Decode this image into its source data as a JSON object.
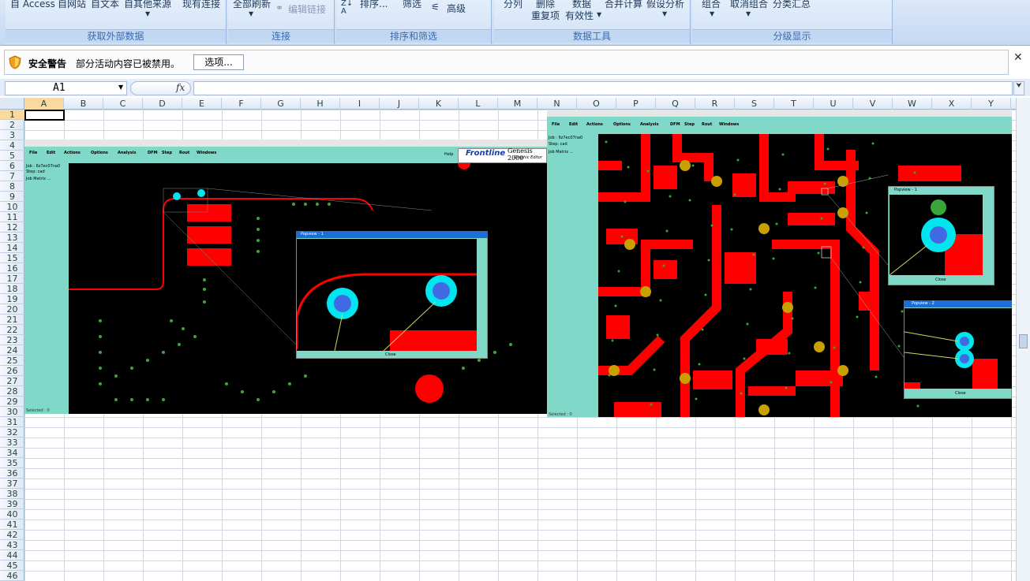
{
  "ribbon": {
    "external_data": {
      "label": "获取外部数据",
      "access": "自 Access",
      "web": "自网站",
      "text": "自文本",
      "other": "自其他来源",
      "existing": "现有连接"
    },
    "connections": {
      "label": "连接",
      "refresh_all": "全部刷新",
      "edit_links": "编辑链接"
    },
    "sort_filter": {
      "label": "排序和筛选",
      "sort": "排序...",
      "filter": "筛选",
      "advanced": "高级"
    },
    "data_tools": {
      "label": "数据工具",
      "split": "分列",
      "remove_dup": "删除",
      "remove_dup2": "重复项",
      "validation": "数据",
      "validation2": "有效性",
      "consolidate": "合并计算",
      "whatif": "假设分析"
    },
    "outline": {
      "label": "分级显示",
      "group": "组合",
      "ungroup": "取消组合",
      "subtotal": "分类汇总"
    }
  },
  "security_bar": {
    "title": "安全警告",
    "message": "部分活动内容已被禁用。",
    "options_button": "选项..."
  },
  "formula_bar": {
    "name_box": "A1",
    "fx": "fx",
    "formula": ""
  },
  "columns": [
    "A",
    "B",
    "C",
    "D",
    "E",
    "F",
    "G",
    "H",
    "I",
    "J",
    "K",
    "L",
    "M",
    "N",
    "O",
    "P",
    "Q",
    "R",
    "S",
    "T",
    "U",
    "V",
    "W",
    "X",
    "Y"
  ],
  "rows": [
    "1",
    "2",
    "3",
    "4",
    "5",
    "6",
    "7",
    "8",
    "9",
    "10",
    "11",
    "12",
    "13",
    "14",
    "15",
    "16",
    "17",
    "18",
    "19",
    "20",
    "21",
    "22",
    "23",
    "24",
    "25",
    "26",
    "27",
    "28",
    "29",
    "30",
    "31",
    "32",
    "33",
    "34",
    "35",
    "36",
    "37",
    "38",
    "39",
    "40",
    "41",
    "42",
    "43",
    "44",
    "45",
    "46"
  ],
  "pic1": {
    "menu": [
      "File",
      "Edit",
      "Actions",
      "Options",
      "Analysis",
      "DFM",
      "Step",
      "Rout",
      "Windows"
    ],
    "help": "Help",
    "brand": "Frontline",
    "product": "Genesis 2000",
    "subtitle": "Graphic Editor",
    "job": "Job : 6z7ec07na0",
    "step": "Step: cad",
    "matrix": "Job Matrix ...",
    "popup_title": "Popview - 1",
    "popup_close": "Close",
    "selected": "Selected : 0"
  },
  "pic2": {
    "menu": [
      "File",
      "Edit",
      "Actions",
      "Options",
      "Analysis",
      "DFM",
      "Step",
      "Rout",
      "Windows"
    ],
    "job": "Job : 6z7ec07na0",
    "step": "Step: cad",
    "matrix": "Job Matrix ...",
    "popup1_title": "Popview - 1",
    "popup1_close": "Close",
    "popup2_title": "Popview - 2",
    "popup2_close": "Close",
    "selected": "Selected : 0"
  },
  "colors": {
    "copper": "#ff0000",
    "pad": "#00e5ee",
    "via": "#4169e1",
    "panel": "#7fd8c8",
    "ribbon": "#c4d9f2"
  }
}
